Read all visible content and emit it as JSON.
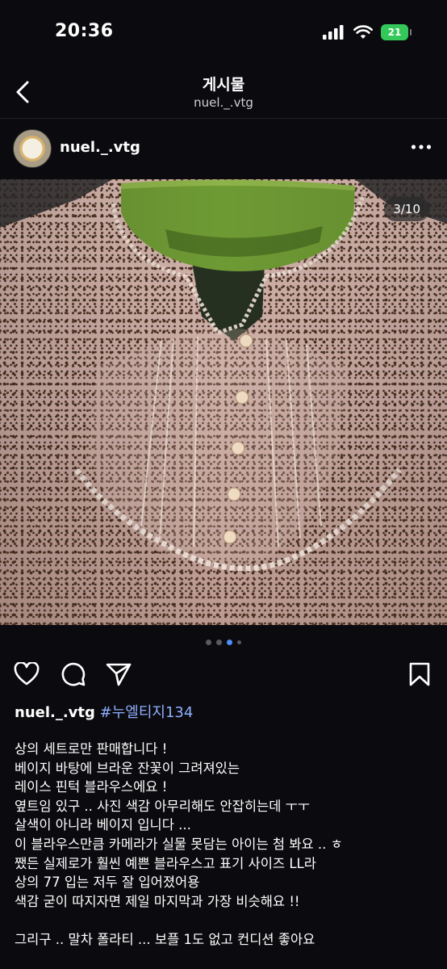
{
  "status_bar": {
    "time": "20:36",
    "battery": "21"
  },
  "nav": {
    "title": "게시물",
    "subtitle": "nuel._.vtg"
  },
  "post": {
    "username": "nuel._.vtg",
    "image_counter": "3/10",
    "carousel": {
      "current": 3,
      "total": 10
    },
    "caption_user": "nuel._.vtg",
    "caption_hashtag": "#누엘티지134",
    "caption_lines": [
      "상의 세트로만 판매합니다 !",
      "베이지 바탕에 브라운 잔꽃이 그려져있는",
      "레이스 핀턱 블라우스에요 !",
      "옆트임 있구 .. 사진 색감 아무리해도 안잡히는데 ㅜㅜ",
      "살색이 아니라 베이지 입니다 ...",
      "이 블라우스만큼 카메라가 실물 못담는 아이는 첨 봐요 .. ㅎ",
      "쨌든 실제로가 훨씬 예쁜 블라우스고 표기 사이즈 LL라",
      "상의 77 입는 저두 잘 입어졌어용",
      "색감 굳이 따지자면 제일 마지막과 가장 비슷해요 !!",
      "",
      "그리구 .. 말차 폴라티 ... 보플 1도 없고 컨디션 좋아요"
    ]
  },
  "colors": {
    "background": "#0b0b0f",
    "hashtag": "#8fb0ff",
    "dot_active": "#4f8ef7",
    "battery": "#34c759"
  },
  "icons": {
    "back": "chevron-left-icon",
    "more": "more-horizontal-icon",
    "like": "heart-icon",
    "comment": "comment-icon",
    "share": "send-icon",
    "save": "bookmark-icon"
  }
}
